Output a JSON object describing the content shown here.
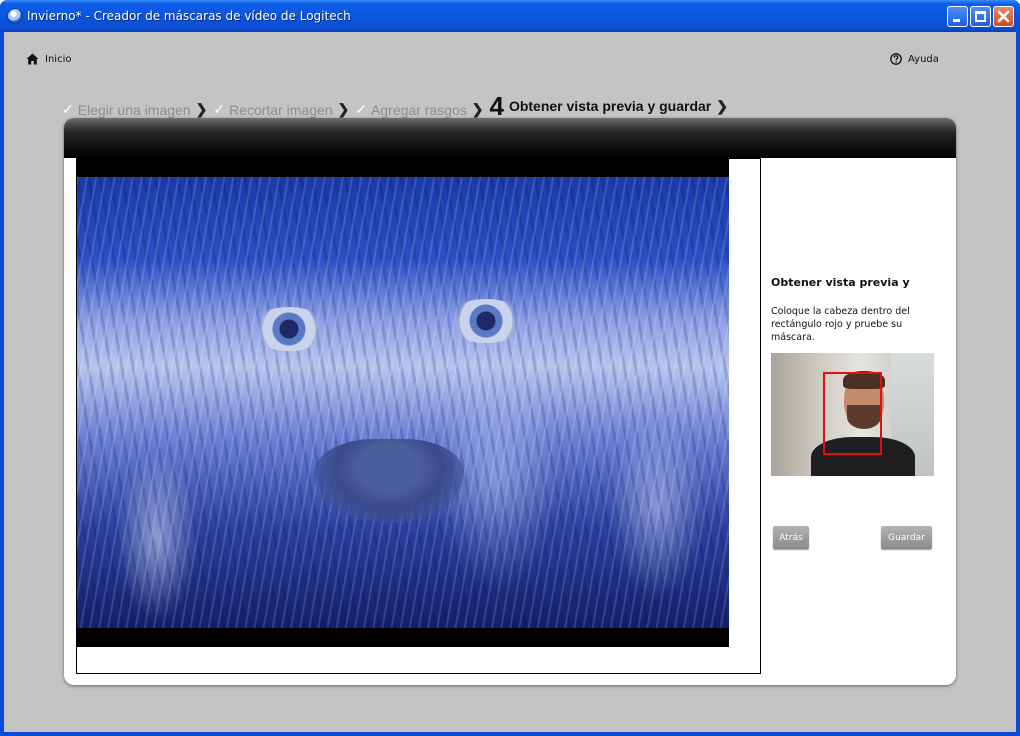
{
  "window": {
    "title": "Invierno* - Creador de máscaras de vídeo de Logitech"
  },
  "nav": {
    "home_label": "Inicio",
    "help_label": "Ayuda"
  },
  "steps": [
    {
      "label": "Elegir una imagen",
      "state": "done"
    },
    {
      "label": "Recortar imagen",
      "state": "done"
    },
    {
      "label": "Agregar rasgos",
      "state": "done"
    },
    {
      "number": "4",
      "label": "Obtener vista previa y guardar",
      "state": "current"
    }
  ],
  "side": {
    "title": "Obtener vista previa y",
    "instructions": "Coloque la cabeza dentro del rectángulo rojo y pruebe su máscara.",
    "back_label": "Atrás",
    "save_label": "Guardar"
  },
  "colors": {
    "titlebar": "#0a56e0",
    "client_bg": "#c4c4c4",
    "face_box": "#e01010",
    "button": "#9a9a9a"
  },
  "icons": {
    "home": "home-icon",
    "help": "help-icon",
    "check": "check-icon",
    "chevron": "chevron-right-icon"
  }
}
